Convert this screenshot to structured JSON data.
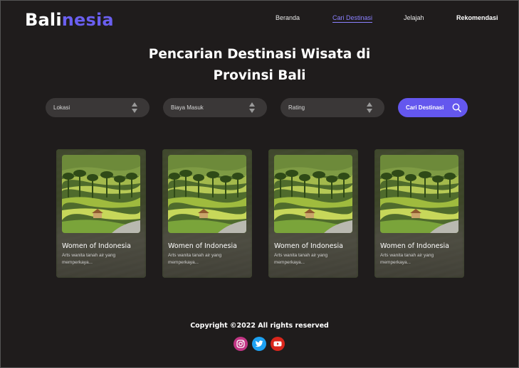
{
  "brand": {
    "part1": "Bali",
    "part2": "nesia"
  },
  "nav": {
    "items": [
      "Beranda",
      "Cari Destinasi",
      "Jelajah",
      "Rekomendasi"
    ]
  },
  "hero": {
    "title_line1": "Pencarian Destinasi Wisata di",
    "title_line2": "Provinsi Bali"
  },
  "filters": {
    "location": "Lokasi",
    "price": "Biaya Masuk",
    "rating": "Rating",
    "search_button": "Cari Destinasi"
  },
  "cards": [
    {
      "title": "Women of Indonesia",
      "desc": "Arts wanita tanah air yang memperkaya..."
    },
    {
      "title": "Women of Indonesia",
      "desc": "Arts wanita tanah air yang memperkaya..."
    },
    {
      "title": "Women of Indonesia",
      "desc": "Arts wanita tanah air yang memperkaya..."
    },
    {
      "title": "Women of Indonesia",
      "desc": "Arts wanita tanah air yang memperkaya..."
    }
  ],
  "footer": {
    "copyright": "Copyright ©2022 All rights reserved",
    "social": [
      "instagram-icon",
      "twitter-icon",
      "youtube-icon"
    ]
  },
  "colors": {
    "background": "#1f1c1c",
    "accent": "#6457ee",
    "filter_bg": "#3a3737",
    "instagram": "#c13584",
    "twitter": "#1da1f2",
    "youtube": "#d9261c"
  }
}
